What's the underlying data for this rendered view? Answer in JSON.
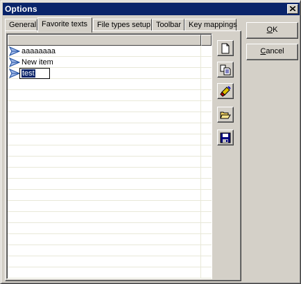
{
  "window": {
    "title": "Options"
  },
  "tabs": [
    {
      "label": "General"
    },
    {
      "label": "Favorite texts"
    },
    {
      "label": "File types setup"
    },
    {
      "label": "Toolbar"
    },
    {
      "label": "Key mappings"
    }
  ],
  "active_tab": "Favorite texts",
  "list": {
    "items": [
      {
        "label": "aaaaaaaa"
      },
      {
        "label": "New item"
      },
      {
        "label": "test",
        "editing": true
      }
    ]
  },
  "toolbar": [
    {
      "icon": "new-item-icon"
    },
    {
      "icon": "copy-item-icon"
    },
    {
      "icon": "delete-item-icon"
    },
    {
      "icon": "open-folder-icon"
    },
    {
      "icon": "save-disk-icon"
    }
  ],
  "buttons": {
    "ok": {
      "accel": "O",
      "rest": "K"
    },
    "cancel": {
      "accel": "C",
      "rest": "ancel"
    }
  },
  "colors": {
    "titlebar": "#0a246a",
    "face": "#d4d0c8",
    "selection": "#0a246a"
  }
}
